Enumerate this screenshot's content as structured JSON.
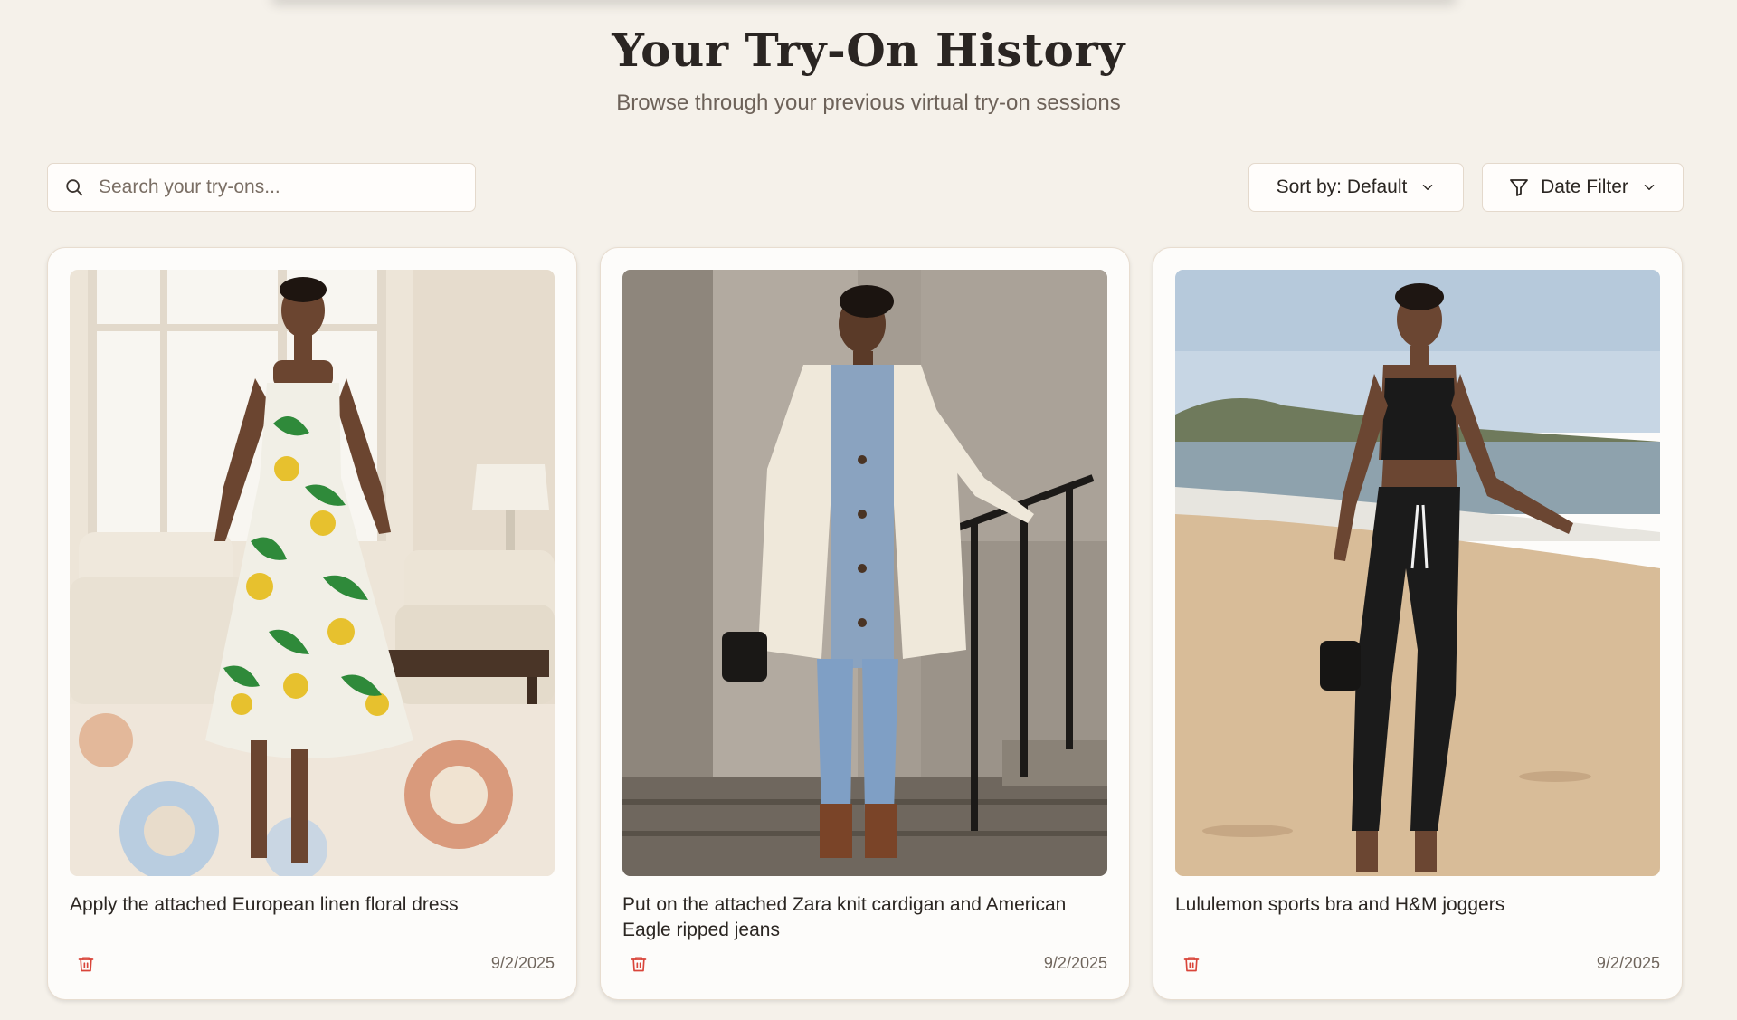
{
  "header": {
    "title": "Your Try-On History",
    "subtitle": "Browse through your previous virtual try-on sessions"
  },
  "search": {
    "placeholder": "Search your try-ons...",
    "value": "",
    "icon": "search-icon"
  },
  "controls": {
    "sort_label": "Sort by: Default",
    "date_filter_label": "Date Filter"
  },
  "colors": {
    "background": "#f5f1ea",
    "card": "#fdfcfa",
    "delete": "#d9453a"
  },
  "cards": [
    {
      "image_description": "model in a green and yellow floral linen dress in a living room",
      "prompt": "Apply the attached European linen floral dress",
      "date": "9/2/2025"
    },
    {
      "image_description": "model in a cream knit cardigan and ripped jeans by stone stairs",
      "prompt": "Put on the attached Zara knit cardigan and American Eagle ripped jeans",
      "date": "9/2/2025"
    },
    {
      "image_description": "model in a black sports bra and joggers on a beach",
      "prompt": "Lululemon sports bra and H&M joggers",
      "date": "9/2/2025"
    }
  ]
}
